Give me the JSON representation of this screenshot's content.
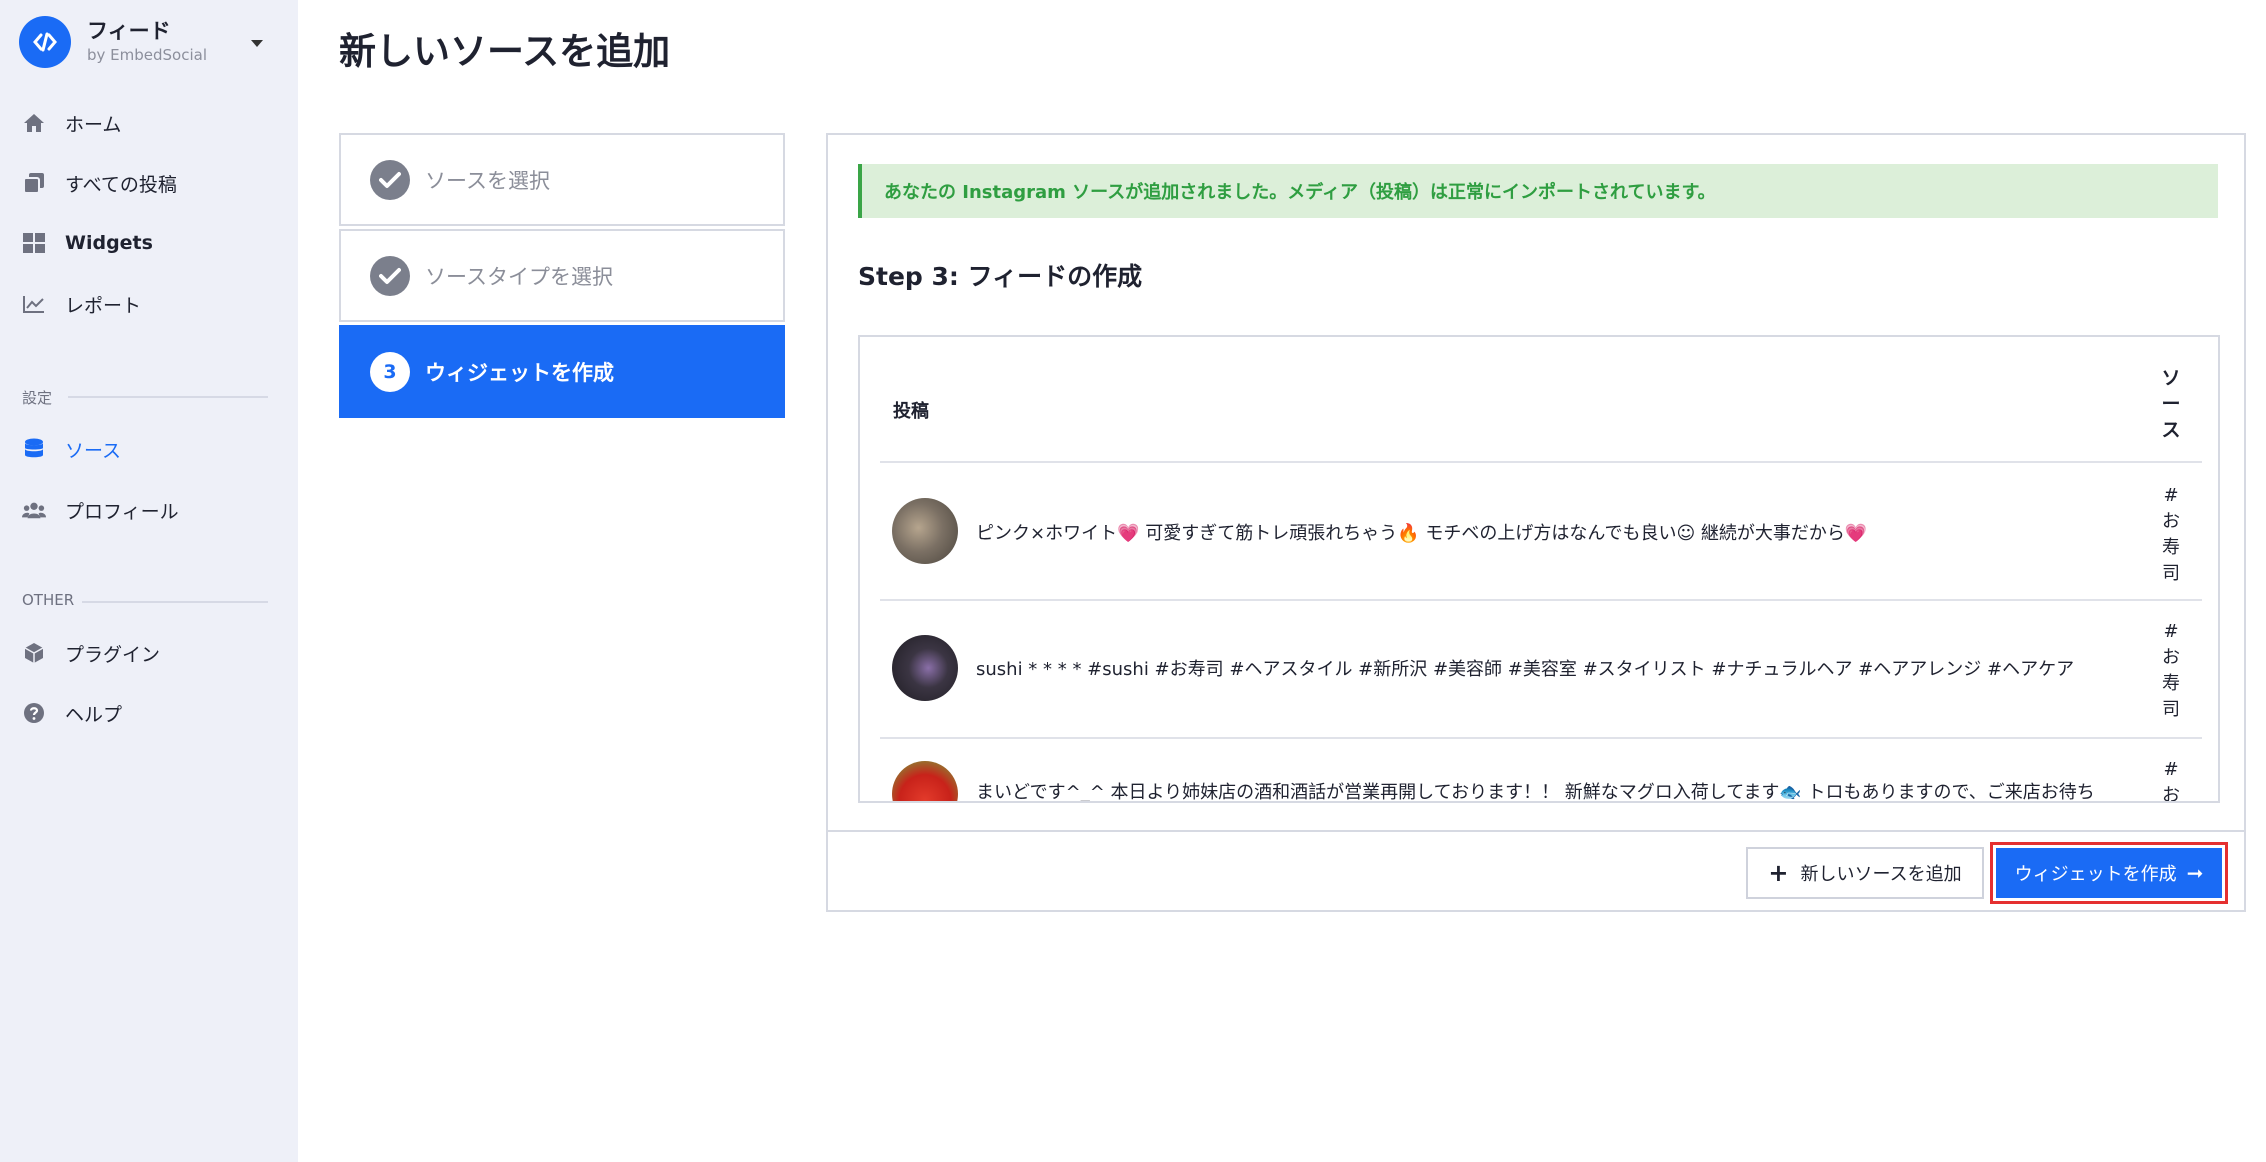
{
  "sidebar": {
    "brand": {
      "title": "フィード",
      "subtitle": "by EmbedSocial"
    },
    "nav": [
      {
        "label": "ホーム",
        "icon": "home-icon"
      },
      {
        "label": "すべての投稿",
        "icon": "copy-icon"
      },
      {
        "label": "Widgets",
        "icon": "grid-icon"
      },
      {
        "label": "レポート",
        "icon": "chart-icon"
      }
    ],
    "settings_label": "設定",
    "settings": [
      {
        "label": "ソース",
        "icon": "database-icon",
        "active": true
      },
      {
        "label": "プロフィール",
        "icon": "users-icon"
      }
    ],
    "other_label": "OTHER",
    "other": [
      {
        "label": "プラグイン",
        "icon": "cube-icon"
      },
      {
        "label": "ヘルプ",
        "icon": "question-icon"
      }
    ]
  },
  "page_title": "新しいソースを追加",
  "steps": [
    {
      "label": "ソースを選択",
      "state": "done"
    },
    {
      "label": "ソースタイプを選択",
      "state": "done"
    },
    {
      "number": "3",
      "label": "ウィジェットを作成",
      "state": "active"
    }
  ],
  "alert": "あなたの Instagram ソースが追加されました。メディア（投稿）は正常にインポートされています。",
  "step_heading": "Step 3: フィードの作成",
  "table": {
    "col_posts": "投稿",
    "col_source": "ソース",
    "rows": [
      {
        "text": "ピンク×ホワイト💗 可愛すぎて筋トレ頑張れちゃう🔥 モチベの上げ方はなんでも良い☺︎ 継続が大事だから💗",
        "source": "#お寿司"
      },
      {
        "text": "sushi * * * * #sushi #お寿司 #ヘアスタイル #新所沢 #美容師 #美容室 #スタイリスト #ナチュラルヘア #ヘアアレンジ #ヘアケア",
        "source": "#お寿司"
      },
      {
        "text": "まいどです^_^ 本日より姉妹店の酒和酒話が営業再開しております！！ 新鮮なマグロ入荷してます🐟 トロもありますので、ご来店お待ち",
        "source": "#お"
      }
    ]
  },
  "buttons": {
    "add_source": "新しいソースを追加",
    "create_widget": "ウィジェットを作成"
  },
  "colors": {
    "accent": "#1a6bf5",
    "success": "#2f9e41",
    "highlight": "#e53030"
  }
}
